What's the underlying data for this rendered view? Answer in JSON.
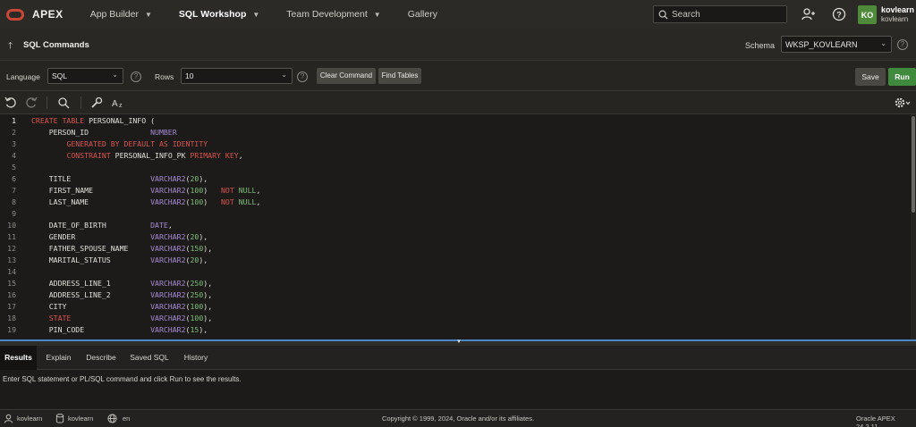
{
  "app": {
    "brand": "APEX",
    "nav": [
      {
        "label": "App Builder",
        "has_menu": true
      },
      {
        "label": "SQL Workshop",
        "has_menu": true,
        "active": true
      },
      {
        "label": "Team Development",
        "has_menu": true
      },
      {
        "label": "Gallery",
        "has_menu": false
      }
    ],
    "search_placeholder": "Search",
    "user": {
      "initials": "KO",
      "name": "kovlearn",
      "workspace": "kovlearn"
    }
  },
  "page": {
    "title": "SQL Commands",
    "schema_label": "Schema",
    "schema_value": "WKSP_KOVLEARN"
  },
  "toolbar": {
    "language_label": "Language",
    "language_value": "SQL",
    "rows_label": "Rows",
    "rows_value": "10",
    "clear_command": "Clear Command",
    "find_tables": "Find Tables",
    "save": "Save",
    "run": "Run"
  },
  "editor": {
    "current_line": 1,
    "lines": [
      {
        "n": "1",
        "tokens": [
          {
            "t": "CREATE TABLE",
            "c": "k"
          },
          {
            "t": " PERSONAL_INFO (",
            "c": ""
          }
        ]
      },
      {
        "n": "2",
        "tokens": [
          {
            "t": "    PERSON_ID              ",
            "c": ""
          },
          {
            "t": "NUMBER",
            "c": "t"
          }
        ]
      },
      {
        "n": "3",
        "tokens": [
          {
            "t": "        ",
            "c": ""
          },
          {
            "t": "GENERATED BY DEFAULT AS IDENTITY",
            "c": "k"
          }
        ]
      },
      {
        "n": "4",
        "tokens": [
          {
            "t": "        ",
            "c": ""
          },
          {
            "t": "CONSTRAINT",
            "c": "k"
          },
          {
            "t": " PERSONAL_INFO_PK ",
            "c": ""
          },
          {
            "t": "PRIMARY KEY",
            "c": "k"
          },
          {
            "t": ",",
            "c": ""
          }
        ]
      },
      {
        "n": "5",
        "tokens": [
          {
            "t": "",
            "c": ""
          }
        ]
      },
      {
        "n": "6",
        "tokens": [
          {
            "t": "    TITLE                  ",
            "c": ""
          },
          {
            "t": "VARCHAR2",
            "c": "t"
          },
          {
            "t": "(",
            "c": ""
          },
          {
            "t": "20",
            "c": "n"
          },
          {
            "t": "),",
            "c": ""
          }
        ]
      },
      {
        "n": "7",
        "tokens": [
          {
            "t": "    FIRST_NAME             ",
            "c": ""
          },
          {
            "t": "VARCHAR2",
            "c": "t"
          },
          {
            "t": "(",
            "c": ""
          },
          {
            "t": "100",
            "c": "n"
          },
          {
            "t": ")   ",
            "c": ""
          },
          {
            "t": "NOT",
            "c": "k"
          },
          {
            "t": " ",
            "c": ""
          },
          {
            "t": "NULL",
            "c": "n"
          },
          {
            "t": ",",
            "c": ""
          }
        ]
      },
      {
        "n": "8",
        "tokens": [
          {
            "t": "    LAST_NAME              ",
            "c": ""
          },
          {
            "t": "VARCHAR2",
            "c": "t"
          },
          {
            "t": "(",
            "c": ""
          },
          {
            "t": "100",
            "c": "n"
          },
          {
            "t": ")   ",
            "c": ""
          },
          {
            "t": "NOT",
            "c": "k"
          },
          {
            "t": " ",
            "c": ""
          },
          {
            "t": "NULL",
            "c": "n"
          },
          {
            "t": ",",
            "c": ""
          }
        ]
      },
      {
        "n": "9",
        "tokens": [
          {
            "t": "",
            "c": ""
          }
        ]
      },
      {
        "n": "10",
        "tokens": [
          {
            "t": "    DATE_OF_BIRTH          ",
            "c": ""
          },
          {
            "t": "DATE",
            "c": "t"
          },
          {
            "t": ",",
            "c": ""
          }
        ]
      },
      {
        "n": "11",
        "tokens": [
          {
            "t": "    GENDER                 ",
            "c": ""
          },
          {
            "t": "VARCHAR2",
            "c": "t"
          },
          {
            "t": "(",
            "c": ""
          },
          {
            "t": "20",
            "c": "n"
          },
          {
            "t": "),",
            "c": ""
          }
        ]
      },
      {
        "n": "12",
        "tokens": [
          {
            "t": "    FATHER_SPOUSE_NAME     ",
            "c": ""
          },
          {
            "t": "VARCHAR2",
            "c": "t"
          },
          {
            "t": "(",
            "c": ""
          },
          {
            "t": "150",
            "c": "n"
          },
          {
            "t": "),",
            "c": ""
          }
        ]
      },
      {
        "n": "13",
        "tokens": [
          {
            "t": "    MARITAL_STATUS         ",
            "c": ""
          },
          {
            "t": "VARCHAR2",
            "c": "t"
          },
          {
            "t": "(",
            "c": ""
          },
          {
            "t": "20",
            "c": "n"
          },
          {
            "t": "),",
            "c": ""
          }
        ]
      },
      {
        "n": "14",
        "tokens": [
          {
            "t": "",
            "c": ""
          }
        ]
      },
      {
        "n": "15",
        "tokens": [
          {
            "t": "    ADDRESS_LINE_1         ",
            "c": ""
          },
          {
            "t": "VARCHAR2",
            "c": "t"
          },
          {
            "t": "(",
            "c": ""
          },
          {
            "t": "250",
            "c": "n"
          },
          {
            "t": "),",
            "c": ""
          }
        ]
      },
      {
        "n": "16",
        "tokens": [
          {
            "t": "    ADDRESS_LINE_2         ",
            "c": ""
          },
          {
            "t": "VARCHAR2",
            "c": "t"
          },
          {
            "t": "(",
            "c": ""
          },
          {
            "t": "250",
            "c": "n"
          },
          {
            "t": "),",
            "c": ""
          }
        ]
      },
      {
        "n": "17",
        "tokens": [
          {
            "t": "    CITY                   ",
            "c": ""
          },
          {
            "t": "VARCHAR2",
            "c": "t"
          },
          {
            "t": "(",
            "c": ""
          },
          {
            "t": "100",
            "c": "n"
          },
          {
            "t": "),",
            "c": ""
          }
        ]
      },
      {
        "n": "18",
        "tokens": [
          {
            "t": "    ",
            "c": ""
          },
          {
            "t": "STATE",
            "c": "k"
          },
          {
            "t": "                  ",
            "c": ""
          },
          {
            "t": "VARCHAR2",
            "c": "t"
          },
          {
            "t": "(",
            "c": ""
          },
          {
            "t": "100",
            "c": "n"
          },
          {
            "t": "),",
            "c": ""
          }
        ]
      },
      {
        "n": "19",
        "tokens": [
          {
            "t": "    PIN_CODE               ",
            "c": ""
          },
          {
            "t": "VARCHAR2",
            "c": "t"
          },
          {
            "t": "(",
            "c": ""
          },
          {
            "t": "15",
            "c": "n"
          },
          {
            "t": "),",
            "c": ""
          }
        ]
      }
    ]
  },
  "results": {
    "tabs": [
      "Results",
      "Explain",
      "Describe",
      "Saved SQL",
      "History"
    ],
    "active_tab": "Results",
    "message": "Enter SQL statement or PL/SQL command and click Run to see the results."
  },
  "footer": {
    "user": "kovlearn",
    "workspace": "kovlearn",
    "language": "en",
    "copyright": "Copyright © 1999, 2024, Oracle and/or its affiliates.",
    "version": "Oracle APEX 24.2.11"
  },
  "colors": {
    "accent_red": "#c74634",
    "run_green": "#3f8a3c",
    "splitter_blue": "#4b87c4"
  }
}
